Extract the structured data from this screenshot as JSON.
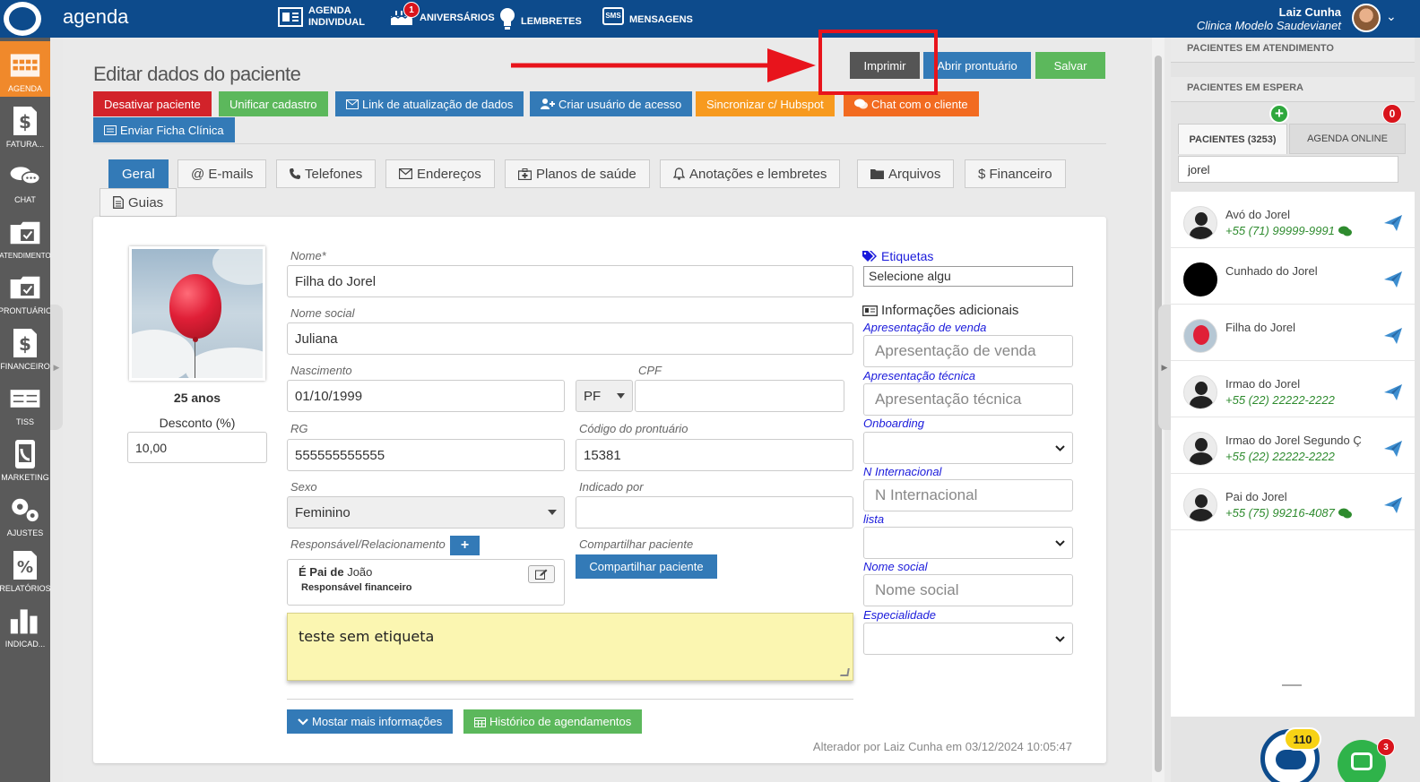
{
  "topbar": {
    "app_title": "agenda",
    "nav": {
      "agenda_individual_1": "AGENDA",
      "agenda_individual_2": "INDIVIDUAL",
      "aniversarios": "ANIVERSÁRIOS",
      "aniversarios_badge": "1",
      "lembretes": "LEMBRETES",
      "mensagens": "MENSAGENS",
      "sms_label": "SMS"
    },
    "user_name": "Laiz Cunha",
    "clinic_name": "Clinica Modelo Saudevianet"
  },
  "sidebar": {
    "items": [
      {
        "label": "AGENDA",
        "icon": "calendar-icon"
      },
      {
        "label": "FATURA...",
        "icon": "dollar-document-icon"
      },
      {
        "label": "CHAT",
        "icon": "chat-icon"
      },
      {
        "label": "ATENDIMENTO",
        "icon": "folder-check-icon"
      },
      {
        "label": "PRONTUÁRIO",
        "icon": "folder-check-icon"
      },
      {
        "label": "FINANCEIRO",
        "icon": "dollar-document-icon"
      },
      {
        "label": "TISS",
        "icon": "card-icon"
      },
      {
        "label": "MARKETING",
        "icon": "phone-icon"
      },
      {
        "label": "AJUSTES",
        "icon": "gears-icon"
      },
      {
        "label": "RELATÓRIOS",
        "icon": "percent-document-icon"
      },
      {
        "label": "INDICAD...",
        "icon": "bar-chart-icon"
      }
    ]
  },
  "page": {
    "title": "Editar dados do paciente",
    "buttons": {
      "imprimir": "Imprimir",
      "abrir_prontuario": "Abrir prontuário",
      "salvar": "Salvar",
      "desativar": "Desativar paciente",
      "unificar": "Unificar cadastro",
      "link_atualizacao": "Link de atualização de dados",
      "criar_usuario": "Criar usuário de acesso",
      "sincronizar": "Sincronizar c/ Hubspot",
      "chat_cliente": "Chat com o cliente",
      "enviar_ficha": "Enviar Ficha Clínica",
      "mostrar_mais": "Mostar mais informações",
      "historico": "Histórico de agendamentos",
      "compartilhar": "Compartilhar paciente"
    },
    "tabs": [
      "Geral",
      "@ E-mails",
      "Telefones",
      "Endereços",
      "Planos de saúde",
      "Anotações e lembretes",
      "Arquivos",
      "$ Financeiro",
      "Guias"
    ]
  },
  "form": {
    "age": "25 anos",
    "desconto_label": "Desconto (%)",
    "desconto_value": "10,00",
    "nome_label": "Nome*",
    "nome_value": "Filha do Jorel",
    "nome_social_label": "Nome social",
    "nome_social_value": "Juliana",
    "nascimento_label": "Nascimento",
    "nascimento_value": "01/10/1999",
    "cpf_label": "CPF",
    "cpf_type": "PF",
    "cpf_value": "",
    "rg_label": "RG",
    "rg_value": "555555555555",
    "codigo_label": "Código do prontuário",
    "codigo_value": "15381",
    "sexo_label": "Sexo",
    "sexo_value": "Feminino",
    "indicado_label": "Indicado por",
    "indicado_value": "",
    "responsavel_label": "Responsável/Relacionamento",
    "relationship_bold": "É Pai de",
    "relationship_name": " João",
    "relationship_sub": "Responsável financeiro",
    "compartilhar_label": "Compartilhar paciente",
    "note_text": "teste sem etiqueta",
    "footer_text": "Alterador por Laiz Cunha em 03/12/2024 10:05:47"
  },
  "extra": {
    "etiquetas_label": "Etiquetas",
    "etiquetas_placeholder": "Selecione algu",
    "info_title": "Informações adicionais",
    "fields": [
      {
        "label": "Apresentação de venda",
        "placeholder": "Apresentação de venda",
        "type": "text"
      },
      {
        "label": "Apresentação técnica",
        "placeholder": "Apresentação técnica",
        "type": "text"
      },
      {
        "label": "Onboarding",
        "placeholder": "",
        "type": "select"
      },
      {
        "label": "N Internacional",
        "placeholder": "N Internacional",
        "type": "text"
      },
      {
        "label": "lista",
        "placeholder": "",
        "type": "select"
      },
      {
        "label": "Nome social",
        "placeholder": "Nome social",
        "type": "text"
      },
      {
        "label": "Especialidade",
        "placeholder": "",
        "type": "select"
      }
    ]
  },
  "right_panel": {
    "em_atendimento": "PACIENTES EM ATENDIMENTO",
    "em_espera": "PACIENTES EM ESPERA",
    "tab_pacientes": "PACIENTES (3253)",
    "tab_agenda_online": "AGENDA ONLINE",
    "agenda_online_badge": "0",
    "search_value": "jorel",
    "patients": [
      {
        "name": "Avó do Jorel",
        "phone": "+55 (71) 99999-9991",
        "whatsapp": true,
        "avatar": "silhouette"
      },
      {
        "name": "Cunhado do Jorel",
        "phone": "",
        "whatsapp": false,
        "avatar": "black"
      },
      {
        "name": "Filha do Jorel",
        "phone": "",
        "whatsapp": false,
        "avatar": "balloon"
      },
      {
        "name": "Irmao do Jorel",
        "phone": "+55 (22) 22222-2222",
        "whatsapp": false,
        "avatar": "silhouette"
      },
      {
        "name": "Irmao do Jorel Segundo Ç",
        "phone": "+55 (22) 22222-2222",
        "whatsapp": false,
        "avatar": "silhouette"
      },
      {
        "name": "Pai do Jorel",
        "phone": "+55 (75) 99216-4087",
        "whatsapp": true,
        "avatar": "silhouette"
      }
    ],
    "notif_badge": "110",
    "chat_badge": "3"
  },
  "colors": {
    "topbar": "#0d4b8c",
    "accent_orange": "#f0892b",
    "primary": "#337ab7",
    "success": "#5cb85c",
    "danger": "#d2232a",
    "highlight": "#e8141c"
  }
}
